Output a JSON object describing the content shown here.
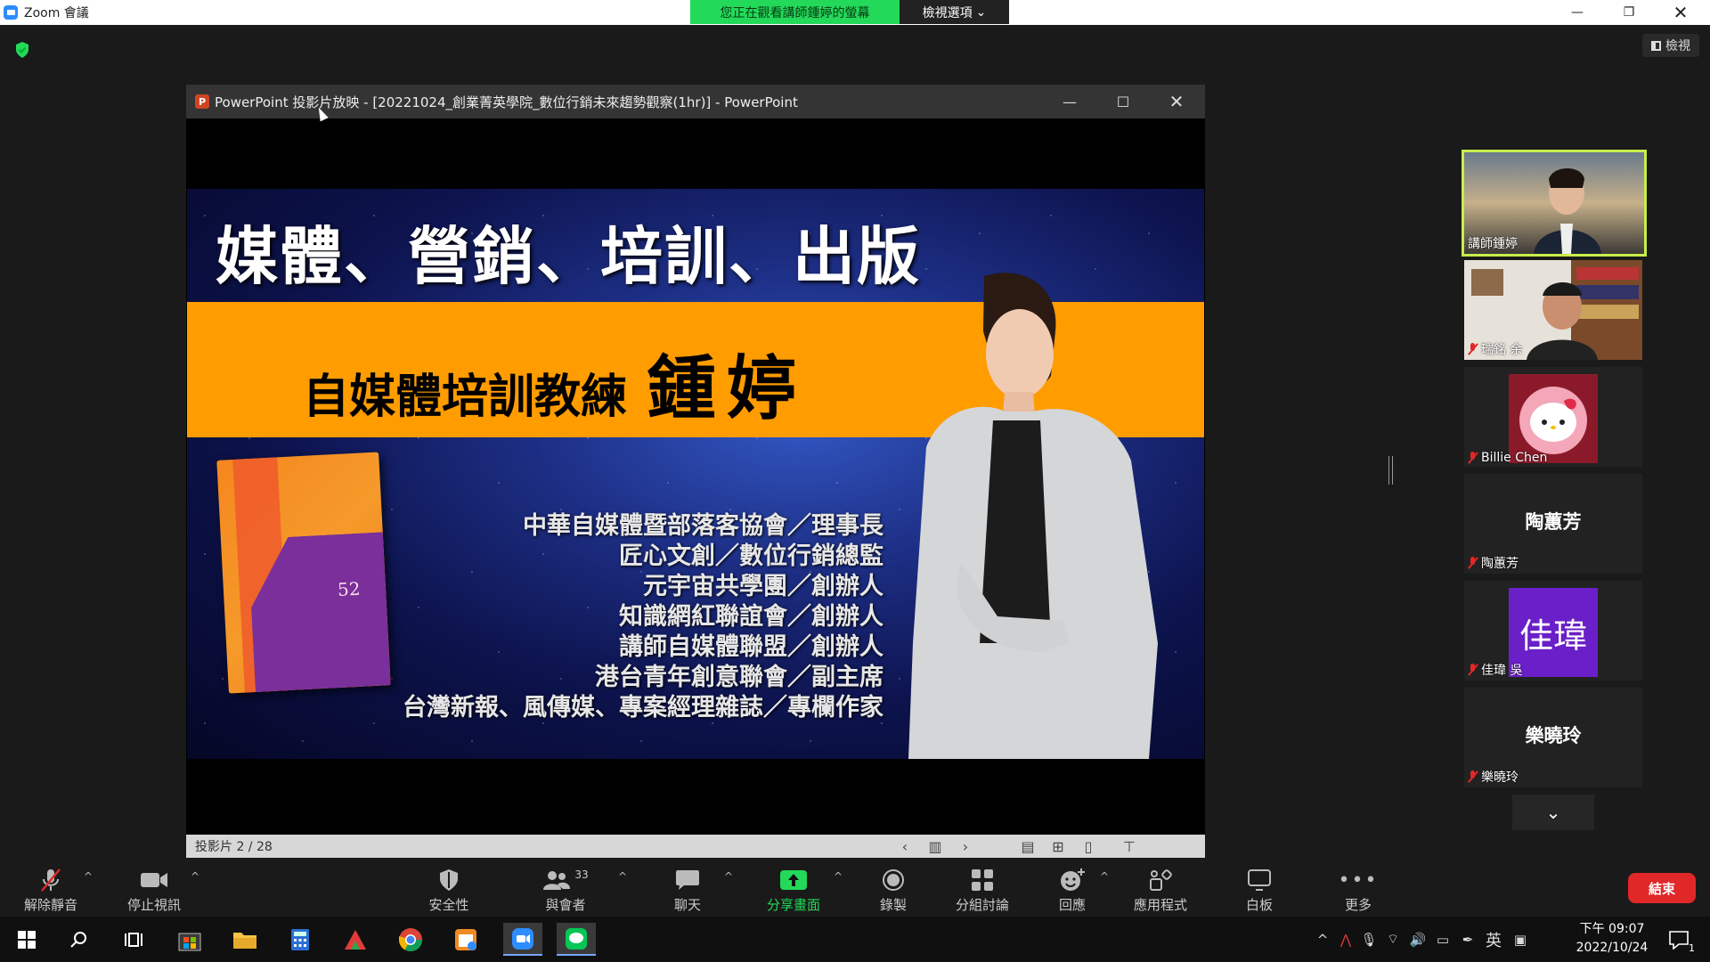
{
  "titlebar": {
    "app_title": "Zoom 會議",
    "share_banner": "您正在觀看講師鍾婷的螢幕",
    "view_options": "檢視選項"
  },
  "view_button": "檢視",
  "ppt_window": {
    "title": "PowerPoint 投影片放映 - [20221024_創業菁英學院_數位行銷未來趨勢觀察(1hr)] - PowerPoint",
    "slide_counter": "投影片 2 / 28"
  },
  "slide": {
    "headline": "媒體、營銷、培訓、出版",
    "role": "自媒體培訓教練",
    "name": "鍾婷",
    "credentials": [
      "中華自媒體暨部落客協會／理事長",
      "匠心文創／數位行銷總監",
      "元宇宙共學團／創辦人",
      "知識網紅聯誼會／創辦人",
      "講師自媒體聯盟／創辦人",
      "港台青年創意聯會／副主席",
      "台灣新報、風傳媒、專案經理雜誌／專欄作家"
    ],
    "book_numeral": "52"
  },
  "participants": [
    {
      "name": "講師鍾婷",
      "display": "",
      "type": "video",
      "muted": false,
      "active": true
    },
    {
      "name": "瑞銘 余",
      "display": "",
      "type": "video",
      "muted": true,
      "active": false
    },
    {
      "name": "Billie Chen",
      "display": "",
      "type": "avatar",
      "muted": true,
      "active": false
    },
    {
      "name": "陶蕙芳",
      "display": "陶蕙芳",
      "type": "text",
      "muted": true,
      "active": false
    },
    {
      "name": "佳瑋 吳",
      "display": "佳瑋",
      "type": "initials",
      "muted": true,
      "active": false
    },
    {
      "name": "樂曉玲",
      "display": "樂曉玲",
      "type": "text",
      "muted": true,
      "active": false
    }
  ],
  "toolbar": {
    "unmute": "解除靜音",
    "stop_video": "停止視訊",
    "security": "安全性",
    "participants": "與會者",
    "participant_count": "33",
    "chat": "聊天",
    "share_screen": "分享畫面",
    "record": "錄製",
    "breakout": "分組討論",
    "reactions": "回應",
    "apps": "應用程式",
    "whiteboard": "白板",
    "more": "更多",
    "end": "結束"
  },
  "taskbar": {
    "ime": "英",
    "time": "下午 09:07",
    "date": "2022/10/24",
    "notification_count": "1"
  },
  "colors": {
    "share_green": "#23d959",
    "end_red": "#e02828",
    "slide_orange": "#ff9c00",
    "active_speaker": "#c8ee4a"
  }
}
